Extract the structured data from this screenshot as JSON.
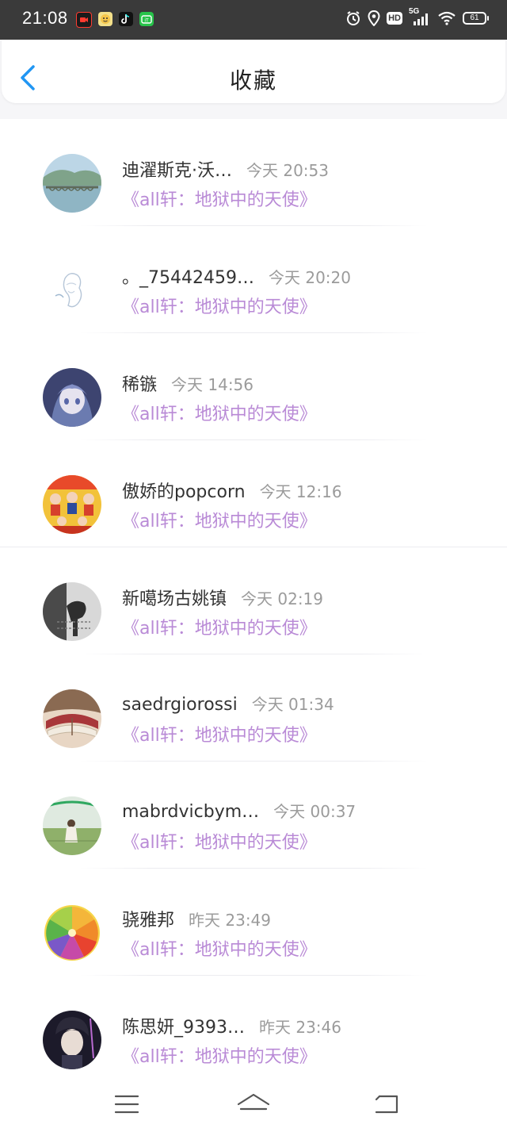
{
  "status_bar": {
    "time": "21:08",
    "notification_icons": [
      "video-app-icon",
      "face-app-icon",
      "tiktok-icon",
      "tv-app-icon"
    ],
    "network_label": "5G",
    "hd_label": "HD",
    "battery_level": "61"
  },
  "header": {
    "title": "收藏",
    "back_icon": "chevron-left-icon"
  },
  "favorites": [
    {
      "username": "迪濯斯克·沃…",
      "time": "今天 20:53",
      "story": "《all轩：地狱中的天使》"
    },
    {
      "username": "。_75442459…",
      "time": "今天 20:20",
      "story": "《all轩：地狱中的天使》"
    },
    {
      "username": "稀镞",
      "time": "今天 14:56",
      "story": "《all轩：地狱中的天使》"
    },
    {
      "username": "傲娇的popcorn",
      "time": "今天 12:16",
      "story": "《all轩：地狱中的天使》"
    },
    {
      "username": "新噶场古姚镇",
      "time": "今天 02:19",
      "story": "《all轩：地狱中的天使》"
    },
    {
      "username": "saedrgiorossi",
      "time": "今天 01:34",
      "story": "《all轩：地狱中的天使》"
    },
    {
      "username": "mabrdvicbym…",
      "time": "今天 00:37",
      "story": "《all轩：地狱中的天使》"
    },
    {
      "username": "骁雅邦",
      "time": "昨天 23:49",
      "story": "《all轩：地狱中的天使》"
    },
    {
      "username": "陈思妍_9393…",
      "time": "昨天 23:46",
      "story": "《all轩：地狱中的天使》"
    }
  ],
  "bottom_nav": {
    "items": [
      "menu-icon",
      "home-icon",
      "back-icon"
    ]
  },
  "colors": {
    "accent_blue": "#2196f3",
    "story_purple": "#b98ad6",
    "timestamp_gray": "#9b9b9b",
    "status_bar_bg": "#3a3a3a"
  }
}
